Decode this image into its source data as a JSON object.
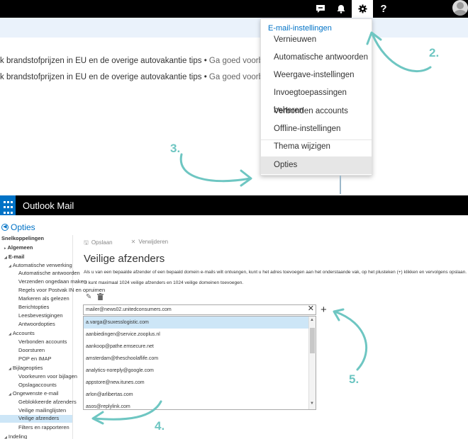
{
  "top": {
    "icons": [
      "chat-icon",
      "bell-icon",
      "gear-icon",
      "help-icon",
      "avatar"
    ],
    "help_glyph": "?",
    "news": [
      {
        "main": "k brandstofprijzen in EU en de overige autovakantie tips",
        "sep": "•",
        "more": "Ga goed voorbereid de weg op met"
      },
      {
        "main": "k brandstofprijzen in EU en de overige autovakantie tips",
        "sep": "•",
        "more": "Ga goed voorbereid de weg op met"
      }
    ],
    "settings_menu": {
      "header": "E-mail-instellingen",
      "items": [
        "Vernieuwen",
        "Automatische antwoorden",
        "Weergave-instellingen",
        "Invoegtoepassingen beheren",
        "Verbonden accounts",
        "Offline-instellingen",
        "Thema wijzigen",
        "Opties"
      ]
    }
  },
  "annotations": [
    "2.",
    "3.",
    "4.",
    "5."
  ],
  "accent_color": "#6ec6c2",
  "app": {
    "title": "Outlook Mail",
    "back_label": "Opties"
  },
  "nav": [
    {
      "label": "Snelkoppelingen",
      "level": 0,
      "bold": true
    },
    {
      "label": "Algemeen",
      "level": 0,
      "bold": true,
      "arrow": "▸"
    },
    {
      "label": "E-mail",
      "level": 0,
      "bold": true,
      "arrow": "◢"
    },
    {
      "label": "Automatische verwerking",
      "level": 1,
      "arrow": "◢"
    },
    {
      "label": "Automatische antwoorden",
      "level": 2
    },
    {
      "label": "Verzenden ongedaan maken",
      "level": 2
    },
    {
      "label": "Regels voor Postvak IN en opruimen",
      "level": 2
    },
    {
      "label": "Markeren als gelezen",
      "level": 2
    },
    {
      "label": "Berichtopties",
      "level": 2
    },
    {
      "label": "Leesbevestigingen",
      "level": 2
    },
    {
      "label": "Antwoordopties",
      "level": 2
    },
    {
      "label": "Accounts",
      "level": 1,
      "arrow": "◢"
    },
    {
      "label": "Verbonden accounts",
      "level": 2
    },
    {
      "label": "Doorsturen",
      "level": 2
    },
    {
      "label": "POP en IMAP",
      "level": 2
    },
    {
      "label": "Bijlageopties",
      "level": 1,
      "arrow": "◢"
    },
    {
      "label": "Voorkeuren voor bijlagen",
      "level": 2
    },
    {
      "label": "Opslagaccounts",
      "level": 2
    },
    {
      "label": "Ongewenste e-mail",
      "level": 1,
      "arrow": "◢"
    },
    {
      "label": "Geblokkeerde afzenders",
      "level": 2
    },
    {
      "label": "Veilige mailinglijsten",
      "level": 2
    },
    {
      "label": "Veilige afzenders",
      "level": 2,
      "selected": true
    },
    {
      "label": "Filters en rapporteren",
      "level": 2
    },
    {
      "label": "Indeling",
      "level": 0,
      "arrow": "◢"
    }
  ],
  "toolbar": {
    "save": "Opslaan",
    "delete": "Verwijderen"
  },
  "content": {
    "heading": "Veilige afzenders",
    "desc1": "Als u van een bepaalde afzender of een bepaald domein e-mails wilt ontvangen, kunt u het adres toevoegen aan het onderstaande vak, op het plusteken (+) klikken en vervolgens opslaan.",
    "desc2": "U kunt maximaal 1024 veilige afzenders en 1024 veilige domeinen toevoegen.",
    "input_value": "mailer@news02.unitedconsumers.com",
    "senders": [
      "a.varga@suxesslogistic.com",
      "aanbiedingen@service.zooplus.nl",
      "aankoop@pathe.emsecure.net",
      "amsterdam@theschoolaflife.com",
      "analytics-noreply@google.com",
      "appstore@new.itunes.com",
      "arlon@arlibertas.com",
      "asos@replylink.com"
    ]
  }
}
